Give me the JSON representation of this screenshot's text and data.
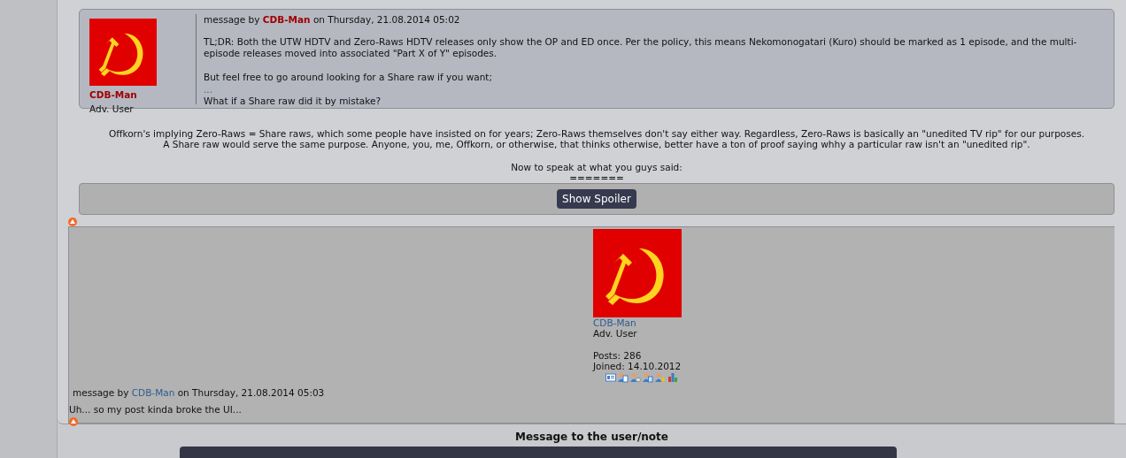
{
  "quote": {
    "author": "CDB-Man",
    "rank": "Adv. User",
    "header": {
      "prefix": "message by ",
      "author": "CDB-Man",
      "suffix": " on Thursday, 21.08.2014 05:02"
    },
    "lines": [
      {
        "kind": "text",
        "text": "TL;DR: Both the UTW HDTV and Zero-Raws HDTV releases only show the OP and ED once. Per the policy, this means Nekomonogatari (Kuro) should be marked as 1 episode, and the multi-episode releases moved into associated \"Part X of Y\" episodes."
      },
      {
        "kind": "gap"
      },
      {
        "kind": "text",
        "text": "But feel free to go around looking for a Share raw if you want;"
      },
      {
        "kind": "link",
        "text": "..."
      },
      {
        "kind": "text",
        "text": "What if a Share raw did it by mistake?"
      }
    ]
  },
  "reply_lines": [
    {
      "kind": "text",
      "text": "Offkorn's implying Zero-Raws = Share raws, which some people have insisted on for years; Zero-Raws themselves don't say either way. Regardless, Zero-Raws is basically an \"unedited TV rip\" for our purposes."
    },
    {
      "kind": "text",
      "text": "A Share raw would serve the same purpose. Anyone, you, me, Offkorn, or otherwise, that thinks otherwise, better have a ton of proof saying whhy a particular raw isn't an \"unedited rip\"."
    },
    {
      "kind": "gap"
    },
    {
      "kind": "text",
      "text": "Now to speak at what you guys said:"
    },
    {
      "kind": "text",
      "text": "======="
    }
  ],
  "spoiler": {
    "button": "Show Spoiler"
  },
  "post": {
    "author": "CDB-Man",
    "rank": "Adv. User",
    "posts": "Posts: 286",
    "joined": "Joined: 14.10.2012",
    "header": {
      "prefix": "message by ",
      "author": "CDB-Man",
      "suffix": " on Thursday, 21.08.2014 05:03"
    },
    "body": "Uh... so my post kinda broke the UI..."
  },
  "note_title": "Message to the user/note"
}
